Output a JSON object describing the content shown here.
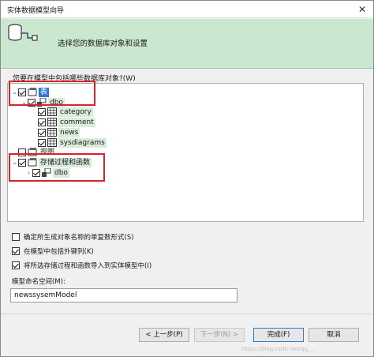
{
  "window": {
    "title": "实体数据模型向导",
    "close": "✕"
  },
  "header": {
    "text": "选择您的数据库对象和设置"
  },
  "tree_prompt": "您要在模型中包括哪些数据库对象?(W)",
  "tree": {
    "tables": {
      "label": "表",
      "checked": true
    },
    "tables_dbo": {
      "label": "dbo",
      "checked": true
    },
    "table_items": [
      {
        "label": "category",
        "checked": true
      },
      {
        "label": "comment",
        "checked": true
      },
      {
        "label": "news",
        "checked": true
      },
      {
        "label": "sysdiagrams",
        "checked": true
      }
    ],
    "views": {
      "label": "视图",
      "checked": false
    },
    "procs": {
      "label": "存储过程和函数",
      "checked": true
    },
    "procs_dbo": {
      "label": "dbo",
      "checked": true
    }
  },
  "options": [
    {
      "label": "确定所生成对象名称的单复数形式(S)",
      "checked": false
    },
    {
      "label": "在模型中包括外键列(K)",
      "checked": true
    },
    {
      "label": "将所选存储过程和函数导入到实体模型中(I)",
      "checked": true
    }
  ],
  "namespace": {
    "label": "模型命名空间(M):",
    "value": "newssysemModel"
  },
  "buttons": {
    "prev": "< 上一步(P)",
    "next": "下一步(N) >",
    "finish": "完成(F)",
    "cancel": "取消"
  },
  "watermark": "https://blog.csdn.net/qq_..."
}
